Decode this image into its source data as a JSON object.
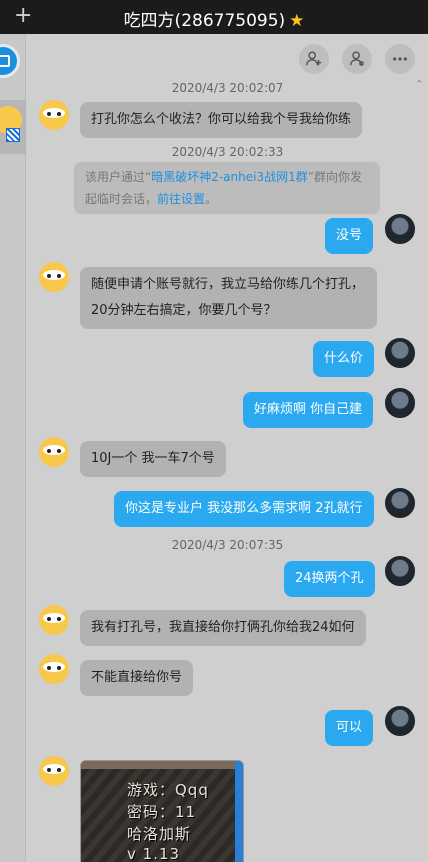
{
  "window": {
    "title": "吃四方(286775095)",
    "new_label": "+"
  },
  "sidebar": {
    "items": [
      {
        "name": "app"
      },
      {
        "name": "contact"
      }
    ]
  },
  "toolbar": {
    "icons": [
      "add-user-icon",
      "user-icon",
      "more-icon"
    ]
  },
  "timestamps": [
    "2020/4/3 20:02:07",
    "2020/4/3 20:02:33",
    "2020/4/3 20:07:35"
  ],
  "notice": {
    "prefix": "该用户通过“",
    "group": "暗黑破坏神2-anhei3战网1群",
    "suffix": "”群向你发起临时会话，",
    "settings_link": "前往设置",
    "end": "。"
  },
  "messages": [
    {
      "dir": "in",
      "text": "打孔你怎么个收法？你可以给我个号我给你练"
    },
    {
      "dir": "out",
      "text": "没号"
    },
    {
      "dir": "in",
      "text": "随便申请个账号就行，我立马给你练几个打孔，20分钟左右搞定，你要几个号？"
    },
    {
      "dir": "out",
      "text": "什么价"
    },
    {
      "dir": "out",
      "text": "好麻烦啊 你自己建"
    },
    {
      "dir": "in",
      "text": "10J一个 我一车7个号"
    },
    {
      "dir": "out",
      "text": "你这是专业户 我没那么多需求啊 2孔就行"
    },
    {
      "dir": "out",
      "text": "24换两个孔"
    },
    {
      "dir": "in",
      "text": "我有打孔号，我直接给你打俩孔你给我24如何"
    },
    {
      "dir": "in",
      "text": "不能直接给你号"
    },
    {
      "dir": "out",
      "text": "可以"
    }
  ],
  "image_message": {
    "lines": [
      "游戏：Qqq",
      "密码：11",
      "哈洛加斯",
      "v 1.13"
    ]
  },
  "colors": {
    "outgoing": "#2aa9f0",
    "incoming": "#b2b2b2",
    "titlebar": "#1b1b1b",
    "link": "#1e8fe0"
  }
}
